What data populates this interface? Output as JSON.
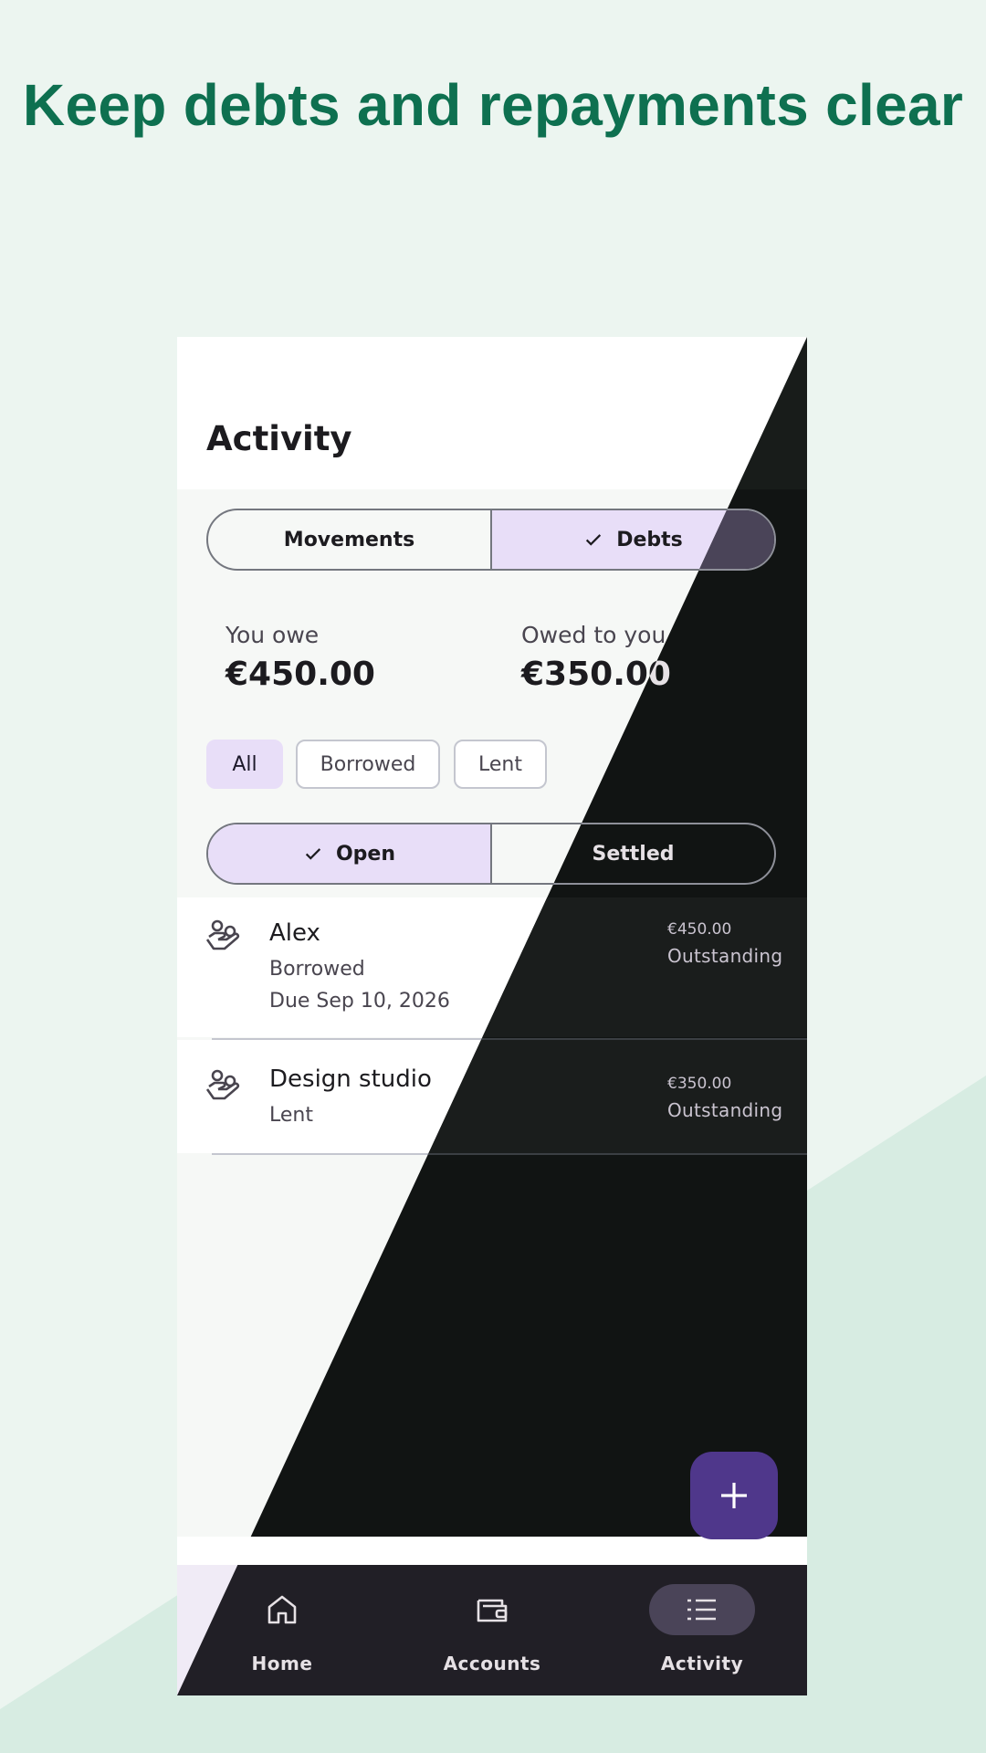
{
  "headline": "Keep debts and repayments clear",
  "colors": {
    "headline": "#0e7050",
    "background": "#ecf5f0",
    "accent_light": "#e8def8",
    "fab": "#4f378b"
  },
  "app": {
    "title": "Activity",
    "tabs": [
      {
        "label": "Movements",
        "selected": false
      },
      {
        "label": "Debts",
        "selected": true
      }
    ],
    "summary": {
      "owe_label": "You owe",
      "owe_value": "€450.00",
      "owed_label": "Owed to you",
      "owed_value": "€350.00"
    },
    "filters": [
      {
        "label": "All",
        "selected": true
      },
      {
        "label": "Borrowed",
        "selected": false
      },
      {
        "label": "Lent",
        "selected": false
      }
    ],
    "status_toggle": [
      {
        "label": "Open",
        "selected": true
      },
      {
        "label": "Settled",
        "selected": false
      }
    ],
    "debts": [
      {
        "name": "Alex",
        "type": "Borrowed",
        "due": "Due Sep 10, 2026",
        "amount": "€450.00",
        "status": "Outstanding",
        "icon": "hand-coins-icon"
      },
      {
        "name": "Design studio",
        "type": "Lent",
        "amount": "€350.00",
        "status": "Outstanding",
        "icon": "hand-coins-icon"
      }
    ],
    "fab": {
      "icon": "plus-icon"
    },
    "nav": [
      {
        "label": "Home",
        "icon": "home-icon",
        "selected": false
      },
      {
        "label": "Accounts",
        "icon": "wallet-icon",
        "selected": false
      },
      {
        "label": "Activity",
        "icon": "list-icon",
        "selected": true
      }
    ]
  }
}
